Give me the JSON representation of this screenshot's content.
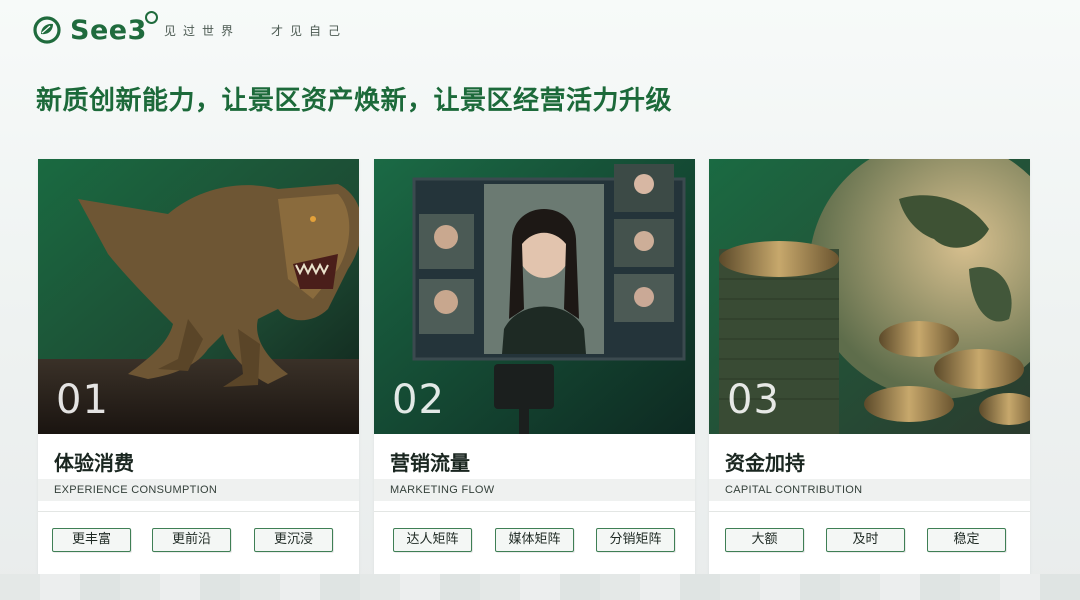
{
  "brand": {
    "name": "See3",
    "slogan": "见过世界   才见自己"
  },
  "headline": "新质创新能力，让景区资产焕新，让景区经营活力升级",
  "cards": [
    {
      "number": "01",
      "title": "体验消费",
      "subtitle": "EXPERIENCE CONSUMPTION",
      "image": "dinosaur-image",
      "tags": [
        "更丰富",
        "更前沿",
        "更沉浸"
      ]
    },
    {
      "number": "02",
      "title": "营销流量",
      "subtitle": "MARKETING FLOW",
      "image": "livestream-image",
      "tags": [
        "达人矩阵",
        "媒体矩阵",
        "分销矩阵"
      ]
    },
    {
      "number": "03",
      "title": "资金加持",
      "subtitle": "CAPITAL CONTRIBUTION",
      "image": "coins-globe-image",
      "tags": [
        "大额",
        "及时",
        "稳定"
      ]
    }
  ],
  "colors": {
    "brand_green": "#1f6b3d",
    "title_green": "#1c6a3a",
    "tag_border": "#3f7f55"
  }
}
